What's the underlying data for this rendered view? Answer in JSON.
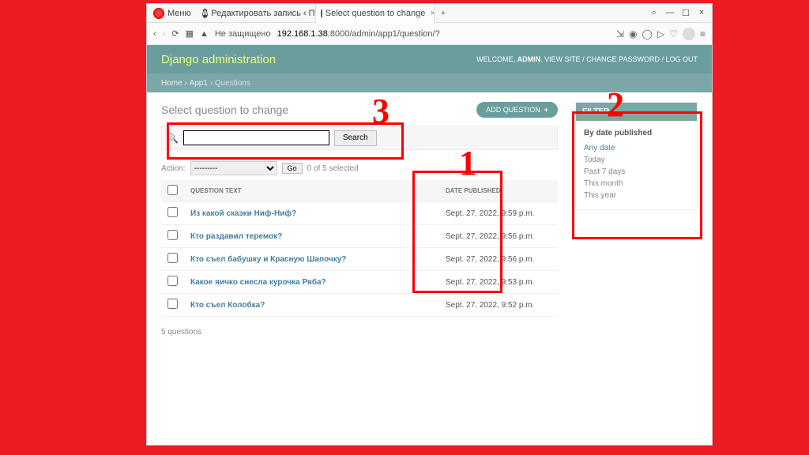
{
  "browser": {
    "menu": "Меню",
    "tabs": [
      {
        "label": "Редактировать запись ‹ П..."
      },
      {
        "label": "Select question to change"
      }
    ],
    "not_secure": "Не защищено",
    "url_host": "192.168.1.38",
    "url_path": ":8000/admin/app1/question/?"
  },
  "header": {
    "title": "Django administration",
    "welcome": "WELCOME, ",
    "user": "ADMIN",
    "links": {
      "view_site": "VIEW SITE",
      "change_password": "CHANGE PASSWORD",
      "log_out": "LOG OUT"
    }
  },
  "breadcrumbs": {
    "home": "Home",
    "app": "App1",
    "current": "Questions"
  },
  "page": {
    "title": "Select question to change",
    "add_button": "ADD QUESTION",
    "search_button": "Search",
    "action_label": "Action:",
    "action_placeholder": "---------",
    "go": "Go",
    "selected": "0 of 5 selected",
    "count": "5 questions"
  },
  "table": {
    "col_question": "QUESTION TEXT",
    "col_date": "DATE PUBLISHED",
    "rows": [
      {
        "text": "Из какой сказки Ниф-Ниф?",
        "date": "Sept. 27, 2022, 9:59 p.m."
      },
      {
        "text": "Кто раздавил теремок?",
        "date": "Sept. 27, 2022, 9:56 p.m."
      },
      {
        "text": "Кто съел бабушку и Красную Шапочку?",
        "date": "Sept. 27, 2022, 9:56 p.m."
      },
      {
        "text": "Какое яичко снесла курочка Ряба?",
        "date": "Sept. 27, 2022, 9:53 p.m."
      },
      {
        "text": "Кто съел Колобка?",
        "date": "Sept. 27, 2022, 9:52 p.m."
      }
    ]
  },
  "filter": {
    "title": "FILTER",
    "subtitle": "By date published",
    "options": [
      "Any date",
      "Today",
      "Past 7 days",
      "This month",
      "This year"
    ],
    "selected_index": 0
  },
  "annotations": {
    "l1": "1",
    "l2": "2",
    "l3": "3"
  }
}
